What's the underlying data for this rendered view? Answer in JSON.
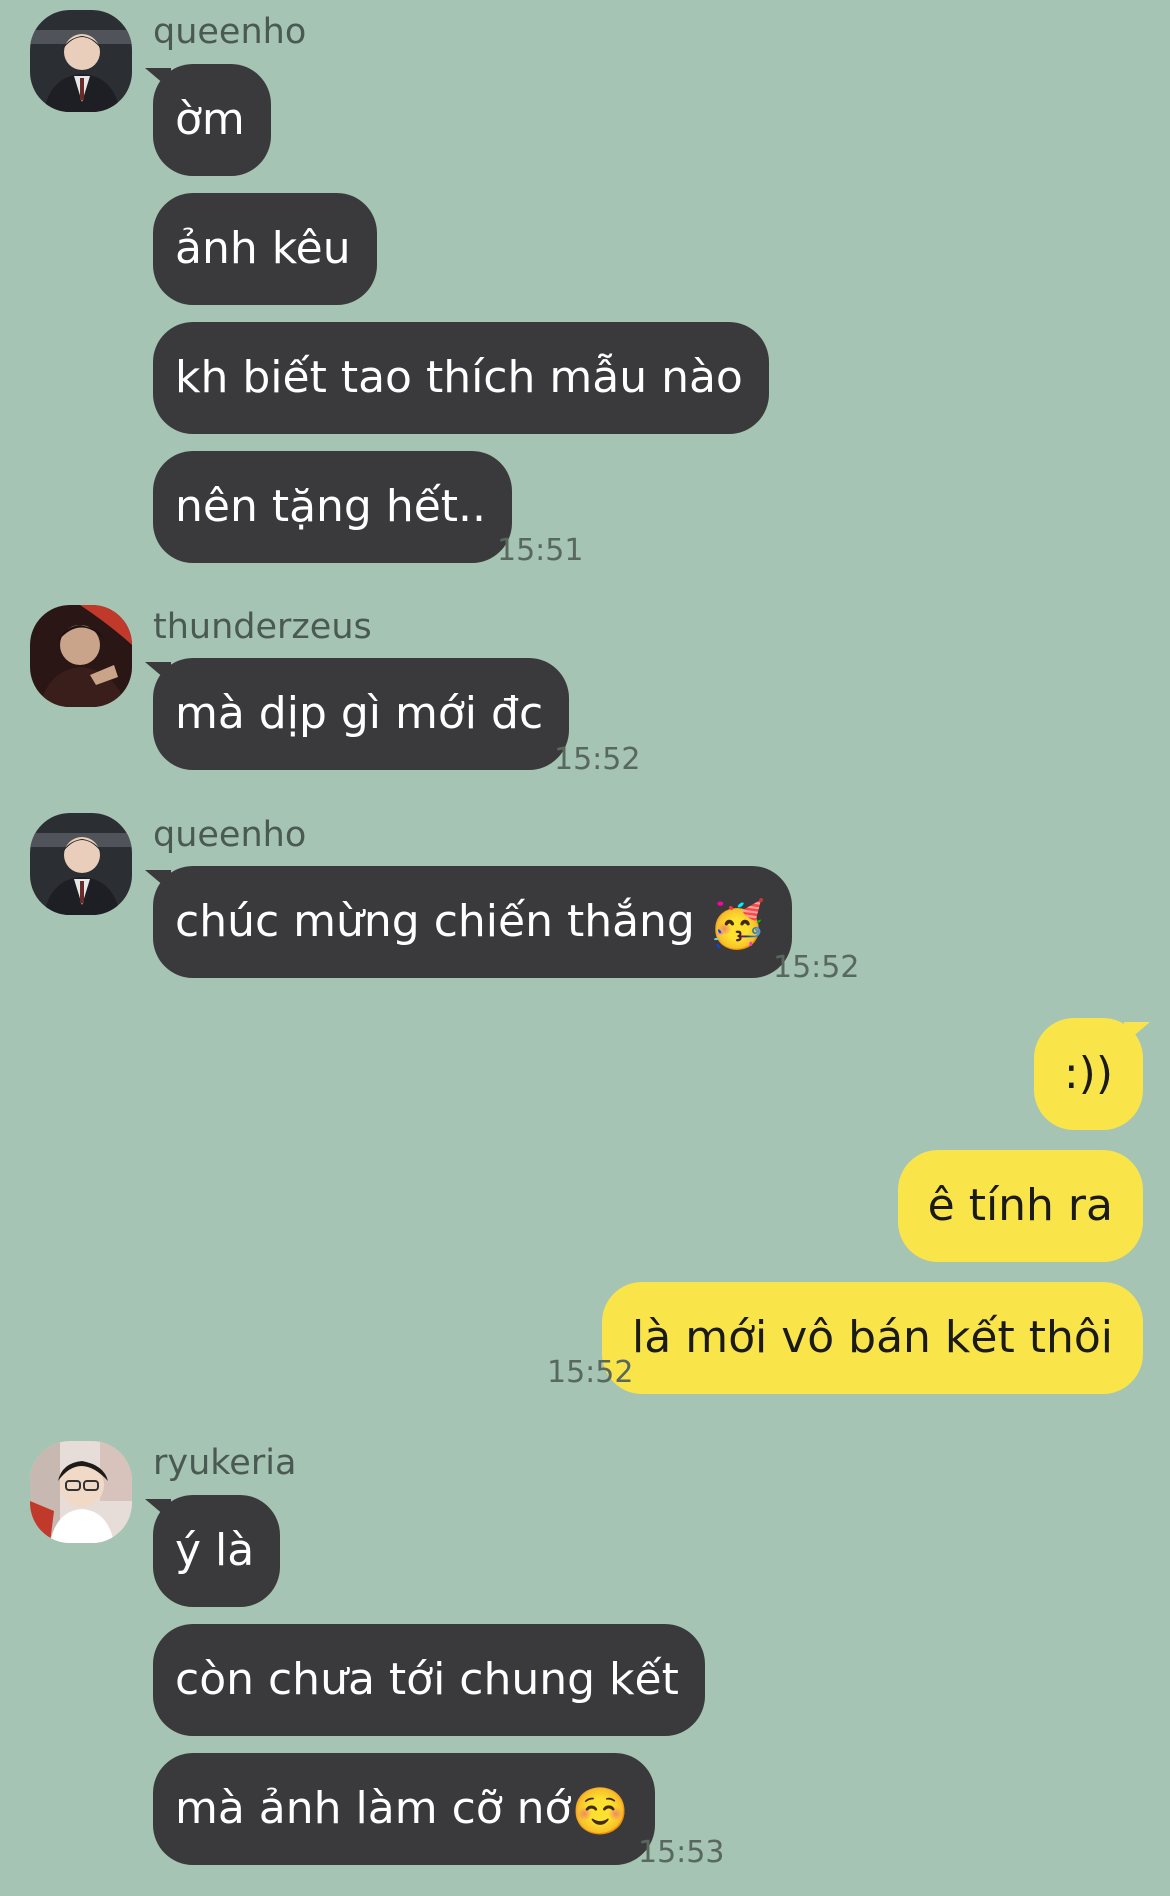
{
  "colors": {
    "background": "#a6c4b4",
    "incoming_bubble": "#3a3a3c",
    "outgoing_bubble": "#f9e44a"
  },
  "groups": [
    {
      "sender": "queenho",
      "avatar_icon": "avatar-queenho",
      "messages": [
        "ờm",
        "ảnh kêu",
        "kh biết tao thích mẫu nào",
        "nên tặng hết.."
      ],
      "time": "15:51"
    },
    {
      "sender": "thunderzeus",
      "avatar_icon": "avatar-thunderzeus",
      "messages": [
        "mà dịp gì mới đc"
      ],
      "time": "15:52"
    },
    {
      "sender": "queenho",
      "avatar_icon": "avatar-queenho",
      "messages": [
        "chúc mừng chiến thắng"
      ],
      "emoji": "🥳",
      "time": "15:52"
    },
    {
      "sender": "",
      "outgoing": true,
      "messages": [
        ":))",
        "ê tính ra",
        "là mới vô bán kết thôi"
      ],
      "time": "15:52"
    },
    {
      "sender": "ryukeria",
      "avatar_icon": "avatar-ryukeria",
      "messages": [
        "ý là",
        "còn chưa tới chung kết",
        "mà ảnh làm cỡ nớ"
      ],
      "emoji": "☺️",
      "time": "15:53"
    }
  ]
}
